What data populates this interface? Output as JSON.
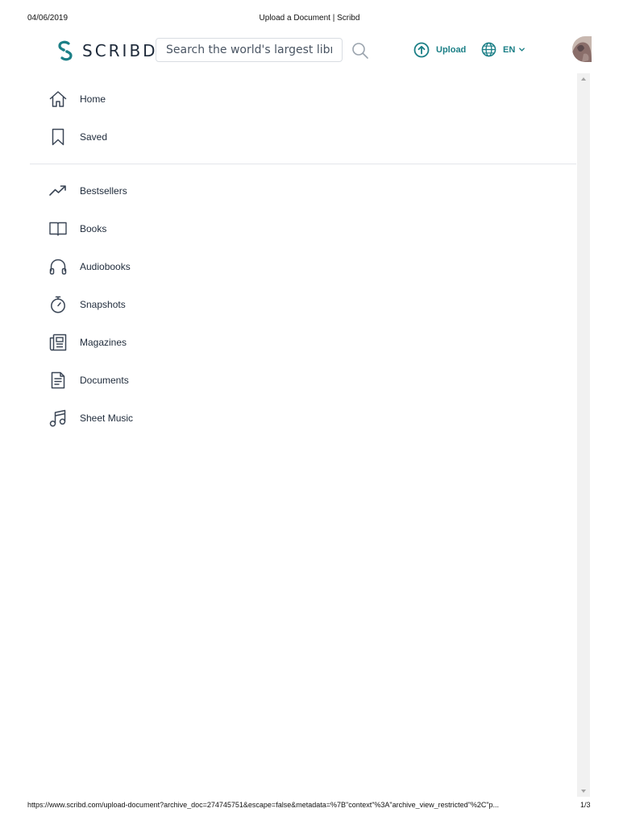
{
  "print_header": {
    "date": "04/06/2019",
    "title": "Upload a Document | Scribd"
  },
  "header": {
    "logo_text": "SCRIBD",
    "search": {
      "placeholder": "Search the world's largest library",
      "value": ""
    },
    "upload_label": "Upload",
    "language": "EN"
  },
  "icons": {
    "logo": "scribd-logo-icon",
    "search": "search-icon",
    "upload": "upload-icon",
    "language": "globe-icon",
    "language_menu": "chevron-down-icon"
  },
  "nav": {
    "primary": [
      {
        "label": "Home",
        "icon": "home-icon"
      },
      {
        "label": "Saved",
        "icon": "bookmark-icon"
      }
    ],
    "categories": [
      {
        "label": "Bestsellers",
        "icon": "trending-up-icon"
      },
      {
        "label": "Books",
        "icon": "book-icon"
      },
      {
        "label": "Audiobooks",
        "icon": "headphones-icon"
      },
      {
        "label": "Snapshots",
        "icon": "stopwatch-icon"
      },
      {
        "label": "Magazines",
        "icon": "magazine-icon"
      },
      {
        "label": "Documents",
        "icon": "document-icon"
      },
      {
        "label": "Sheet Music",
        "icon": "music-note-icon"
      }
    ]
  },
  "print_footer": {
    "url": "https://www.scribd.com/upload-document?archive_doc=274745751&escape=false&metadata=%7B\"context\"%3A\"archive_view_restricted\"%2C\"p...",
    "page": "1/3"
  },
  "colors": {
    "accent": "#1b7f86",
    "text": "#1e2a3a",
    "icon_stroke": "#3b4656",
    "divider": "#e3e6ea"
  }
}
